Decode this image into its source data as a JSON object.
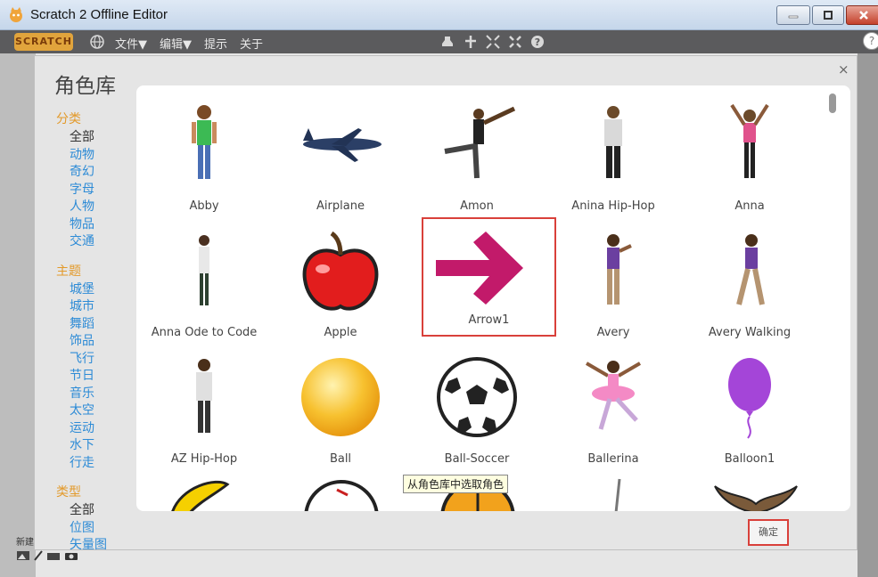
{
  "window": {
    "title": "Scratch 2 Offline Editor"
  },
  "menubar": {
    "logo_text": "SCRATCH",
    "items": [
      "文件▼",
      "编辑▼",
      "提示",
      "关于"
    ]
  },
  "dialog": {
    "title": "角色库",
    "close_label": "×",
    "tooltip": "从角色库中选取角色",
    "ok_label": "确定"
  },
  "sidebar": {
    "category_heading": "分类",
    "categories": [
      "全部",
      "动物",
      "奇幻",
      "字母",
      "人物",
      "物品",
      "交通"
    ],
    "theme_heading": "主题",
    "themes": [
      "城堡",
      "城市",
      "舞蹈",
      "饰品",
      "飞行",
      "节日",
      "音乐",
      "太空",
      "运动",
      "水下",
      "行走"
    ],
    "type_heading": "类型",
    "types": [
      "全部",
      "位图",
      "矢量图"
    ]
  },
  "sprites": [
    {
      "name": "Abby",
      "icon": "girl-figure"
    },
    {
      "name": "Airplane",
      "icon": "airplane"
    },
    {
      "name": "Amon",
      "icon": "dancer-figure"
    },
    {
      "name": "Anina Hip-Hop",
      "icon": "hiphop-figure"
    },
    {
      "name": "Anna",
      "icon": "girl-arms-up"
    },
    {
      "name": "Anna Ode to Code",
      "icon": "girl-figure"
    },
    {
      "name": "Apple",
      "icon": "apple"
    },
    {
      "name": "Arrow1",
      "icon": "arrow",
      "selected": true
    },
    {
      "name": "Avery",
      "icon": "girl-figure"
    },
    {
      "name": "Avery Walking",
      "icon": "girl-walking"
    },
    {
      "name": "AZ Hip-Hop",
      "icon": "boy-figure"
    },
    {
      "name": "Ball",
      "icon": "ball"
    },
    {
      "name": "Ball-Soccer",
      "icon": "soccer-ball"
    },
    {
      "name": "Ballerina",
      "icon": "ballerina"
    },
    {
      "name": "Balloon1",
      "icon": "balloon"
    }
  ],
  "editor": {
    "new_label": "新建",
    "help_glyph": "?"
  }
}
